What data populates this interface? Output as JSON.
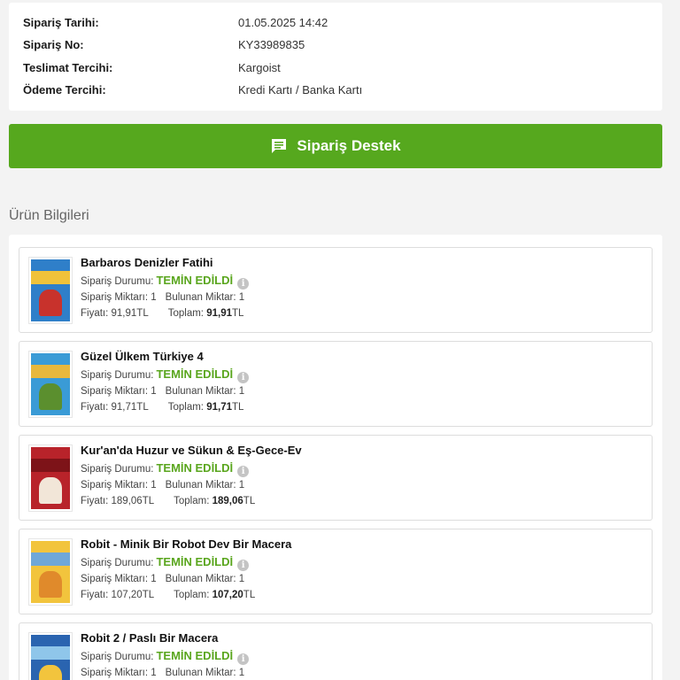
{
  "order": {
    "rows": [
      {
        "label": "Sipariş Tarihi:",
        "value": "01.05.2025 14:42"
      },
      {
        "label": "Sipariş No:",
        "value": "KY33989835"
      },
      {
        "label": "Teslimat Tercihi:",
        "value": "Kargoist"
      },
      {
        "label": "Ödeme Tercihi:",
        "value": "Kredi Kartı / Banka Kartı"
      }
    ]
  },
  "support_button": {
    "label": "Sipariş Destek",
    "icon": "chat-message-icon"
  },
  "section_title": "Ürün Bilgileri",
  "labels": {
    "status": "Sipariş Durumu:",
    "ordered_qty": "Sipariş Miktarı:",
    "found_qty": "Bulunan Miktar:",
    "price": "Fiyatı:",
    "total": "Toplam:",
    "info_glyph": "i"
  },
  "colors": {
    "accent": "#56a81e",
    "status": "#5aa61e"
  },
  "items": [
    {
      "title": "Barbaros Denizler Fatihi",
      "status": "TEMİN EDİLDİ",
      "ordered_qty": "1",
      "found_qty": "1",
      "price": "91,91",
      "price_unit": "TL",
      "total": "91,91",
      "total_unit": "TL",
      "cover_colors": [
        "#2f7fc9",
        "#f0c23a",
        "#c8322c"
      ]
    },
    {
      "title": "Güzel Ülkem Türkiye 4",
      "status": "TEMİN EDİLDİ",
      "ordered_qty": "1",
      "found_qty": "1",
      "price": "91,71",
      "price_unit": "TL",
      "total": "91,71",
      "total_unit": "TL",
      "cover_colors": [
        "#3a9bd6",
        "#e8b83c",
        "#5b8f2e"
      ]
    },
    {
      "title": "Kur'an'da Huzur ve Sükun & Eş-Gece-Ev",
      "status": "TEMİN EDİLDİ",
      "ordered_qty": "1",
      "found_qty": "1",
      "price": "189,06",
      "price_unit": "TL",
      "total": "189,06",
      "total_unit": "TL",
      "cover_colors": [
        "#b8232a",
        "#7d1318",
        "#f2e6d8"
      ]
    },
    {
      "title": "Robit - Minik Bir Robot Dev Bir Macera",
      "status": "TEMİN EDİLDİ",
      "ordered_qty": "1",
      "found_qty": "1",
      "price": "107,20",
      "price_unit": "TL",
      "total": "107,20",
      "total_unit": "TL",
      "cover_colors": [
        "#f2c43d",
        "#6fa7d8",
        "#e08a2b"
      ]
    },
    {
      "title": "Robit 2 / Paslı Bir Macera",
      "status": "TEMİN EDİLDİ",
      "ordered_qty": "1",
      "found_qty": "1",
      "price": "",
      "price_unit": "",
      "total": "",
      "total_unit": "",
      "cover_colors": [
        "#2a64b0",
        "#8fc6ea",
        "#f2c43d"
      ]
    }
  ]
}
